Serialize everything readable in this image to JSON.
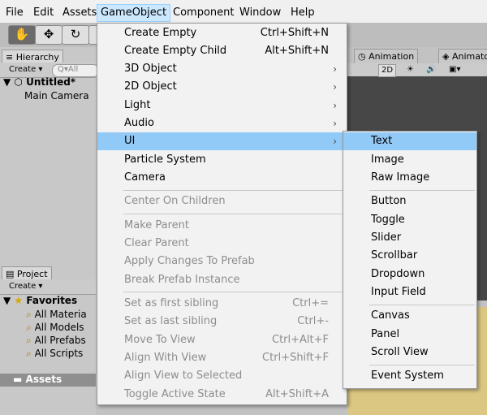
{
  "menubar": {
    "items": [
      "File",
      "Edit",
      "Assets",
      "GameObject",
      "Component",
      "Window",
      "Help"
    ],
    "active": "GameObject"
  },
  "toolbar": {
    "tools": [
      "hand-tool",
      "move-tool",
      "rotate-tool",
      "scale-tool"
    ]
  },
  "hierarchy": {
    "tab": "Hierarchy",
    "create_label": "Create ▾",
    "search_placeholder": "Q▾All",
    "scene_name": "Untitled*",
    "items": [
      "Main Camera"
    ]
  },
  "project": {
    "tab": "Project",
    "create_label": "Create ▾",
    "favorites_label": "Favorites",
    "favorites": [
      "All Materia",
      "All Models",
      "All Prefabs",
      "All Scripts"
    ],
    "assets_label": "Assets"
  },
  "scene": {
    "tabs": [
      "Animation",
      "Animato"
    ],
    "toolbar": {
      "mode_2d": "2D"
    }
  },
  "gameobject_menu": {
    "groups": [
      [
        {
          "label": "Create Empty",
          "shortcut": "Ctrl+Shift+N"
        },
        {
          "label": "Create Empty Child",
          "shortcut": "Alt+Shift+N"
        },
        {
          "label": "3D Object",
          "submenu": true
        },
        {
          "label": "2D Object",
          "submenu": true
        },
        {
          "label": "Light",
          "submenu": true
        },
        {
          "label": "Audio",
          "submenu": true
        },
        {
          "label": "UI",
          "submenu": true,
          "highlighted": true
        },
        {
          "label": "Particle System"
        },
        {
          "label": "Camera"
        }
      ],
      [
        {
          "label": "Center On Children",
          "disabled": true
        }
      ],
      [
        {
          "label": "Make Parent",
          "disabled": true
        },
        {
          "label": "Clear Parent",
          "disabled": true
        },
        {
          "label": "Apply Changes To Prefab",
          "disabled": true
        },
        {
          "label": "Break Prefab Instance",
          "disabled": true
        }
      ],
      [
        {
          "label": "Set as first sibling",
          "shortcut": "Ctrl+=",
          "disabled": true
        },
        {
          "label": "Set as last sibling",
          "shortcut": "Ctrl+-",
          "disabled": true
        },
        {
          "label": "Move To View",
          "shortcut": "Ctrl+Alt+F",
          "disabled": true
        },
        {
          "label": "Align With View",
          "shortcut": "Ctrl+Shift+F",
          "disabled": true
        },
        {
          "label": "Align View to Selected",
          "disabled": true
        },
        {
          "label": "Toggle Active State",
          "shortcut": "Alt+Shift+A",
          "disabled": true
        }
      ]
    ]
  },
  "ui_submenu": {
    "groups": [
      [
        {
          "label": "Text",
          "highlighted": true
        },
        {
          "label": "Image"
        },
        {
          "label": "Raw Image"
        }
      ],
      [
        {
          "label": "Button"
        },
        {
          "label": "Toggle"
        },
        {
          "label": "Slider"
        },
        {
          "label": "Scrollbar"
        },
        {
          "label": "Dropdown"
        },
        {
          "label": "Input Field"
        }
      ],
      [
        {
          "label": "Canvas"
        },
        {
          "label": "Panel"
        },
        {
          "label": "Scroll View"
        }
      ],
      [
        {
          "label": "Event System"
        }
      ]
    ]
  },
  "colors": {
    "highlight": "#91c9f7",
    "menu_bg": "#f2f2f2",
    "disabled_text": "#8d8d8d",
    "scene_bg": "#474747",
    "game_bg": "#dbc782"
  }
}
